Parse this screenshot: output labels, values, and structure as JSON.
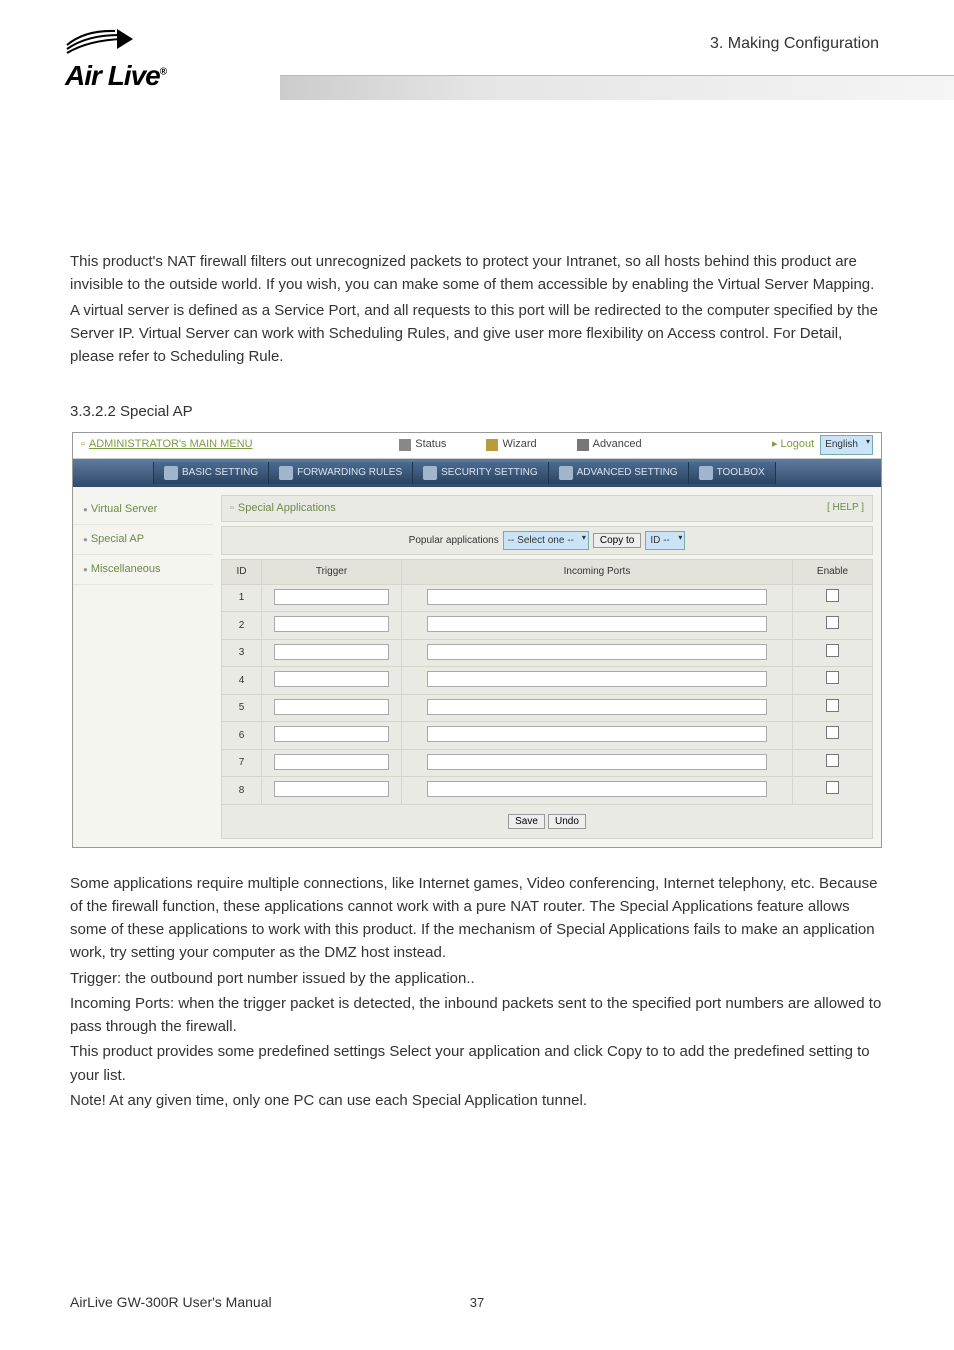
{
  "header": {
    "chapter": "3.  Making  Configuration",
    "logo_text_pre": "Air",
    "logo_text_post": "Live",
    "logo_reg": "®"
  },
  "body": {
    "p1": "This product's NAT firewall filters out unrecognized packets to protect your Intranet, so all hosts behind this product are invisible to the outside world. If you wish, you can make some of them accessible by enabling the Virtual Server Mapping.",
    "p2": "A virtual server is defined as a Service Port, and all requests to this port will be redirected to the computer specified by the Server IP.    Virtual Server can work with Scheduling Rules, and give user more flexibility on Access control. For Detail, please refer to Scheduling Rule.",
    "heading": "3.3.2.2 Special AP",
    "p3": "Some applications require multiple connections, like Internet games, Video conferencing, Internet telephony, etc. Because of the firewall function, these applications cannot work with a pure NAT router. The Special Applications feature allows some of these applications to work with this product. If the mechanism of Special Applications fails to make an application work, try setting your computer as the DMZ host instead.",
    "p4": "Trigger: the outbound port number issued by the application..",
    "p5": "Incoming Ports: when the trigger packet is detected, the inbound packets sent to the specified port numbers are allowed to pass through the firewall.",
    "p6": "This product provides some predefined settings Select your application and click Copy to to add the predefined setting to your list.",
    "p7": "Note! At any given time, only one PC can use each Special Application tunnel."
  },
  "admin": {
    "main_menu": "ADMINISTRATOR's MAIN MENU",
    "status": "Status",
    "wizard": "Wizard",
    "advanced": "Advanced",
    "logout": "▸ Logout",
    "lang": "English",
    "nav": {
      "basic": "BASIC SETTING",
      "forwarding": "FORWARDING RULES",
      "security": "SECURITY SETTING",
      "advanced": "ADVANCED SETTING",
      "toolbox": "TOOLBOX"
    },
    "side": {
      "virtual_server": "Virtual Server",
      "special_ap": "Special AP",
      "misc": "Miscellaneous"
    },
    "section_title": "Special Applications",
    "help": "[ HELP ]",
    "popular_label": "Popular applications",
    "popular_select": "-- Select one --",
    "copy_btn": "Copy to",
    "id_select": "ID --",
    "cols": {
      "id": "ID",
      "trigger": "Trigger",
      "incoming": "Incoming Ports",
      "enable": "Enable"
    },
    "rows": [
      "1",
      "2",
      "3",
      "4",
      "5",
      "6",
      "7",
      "8"
    ],
    "save": "Save",
    "undo": "Undo"
  },
  "footer": {
    "manual": "AirLive GW-300R User's Manual",
    "page": "37"
  }
}
